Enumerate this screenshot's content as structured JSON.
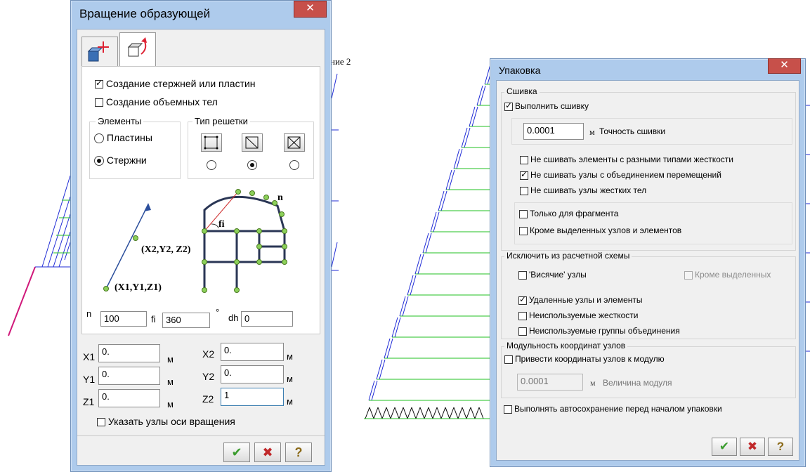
{
  "background": {
    "label_fragment": "ние 2"
  },
  "rotation_dialog": {
    "title": "Вращение образующей",
    "close_symbol": "✕",
    "checkbox_rods_or_plates": {
      "label": "Создание стержней или пластин",
      "checked": true
    },
    "checkbox_solids": {
      "label": "Создание объемных тел",
      "checked": false
    },
    "elements_group": {
      "title": "Элементы",
      "option_plates": "Пластины",
      "option_rods": "Стержни",
      "selected": "Стержни"
    },
    "grid_type_group": {
      "title": "Тип решетки",
      "selected_index": 1
    },
    "diagram": {
      "point2": "(X2,Y2, Z2)",
      "point1": "(X1,Y1,Z1)",
      "angle": "fi",
      "count": "n"
    },
    "param_n": {
      "label": "n",
      "value": "100"
    },
    "param_fi": {
      "label": "fi",
      "value": "360",
      "unit": "°"
    },
    "param_dh": {
      "label": "dh",
      "value": "0"
    },
    "coords": {
      "x1": {
        "label": "X1",
        "value": "0.",
        "unit": "м"
      },
      "y1": {
        "label": "Y1",
        "value": "0.",
        "unit": "м"
      },
      "z1": {
        "label": "Z1",
        "value": "0.",
        "unit": "м"
      },
      "x2": {
        "label": "X2",
        "value": "0.",
        "unit": "м"
      },
      "y2": {
        "label": "Y2",
        "value": "0.",
        "unit": "м"
      },
      "z2": {
        "label": "Z2",
        "value": "1",
        "unit": "м"
      }
    },
    "checkbox_axis_nodes": {
      "label": "Указать узлы оси вращения",
      "checked": false
    },
    "buttons": {
      "ok": "✔",
      "cancel": "✖",
      "help": "?"
    }
  },
  "pack_dialog": {
    "title": "Упаковка",
    "close_symbol": "✕",
    "stitch_group": {
      "title": "Сшивка",
      "do_stitch": {
        "label": "Выполнить сшивку",
        "checked": true
      },
      "precision_value": "0.0001",
      "precision_unit": "м",
      "precision_label": "Точность сшивки",
      "no_diff_stiffness": {
        "label": "Не сшивать элементы с разными типами жесткости",
        "checked": false
      },
      "no_merge_disp": {
        "label": "Не сшивать узлы с объединением перемещений",
        "checked": true
      },
      "no_rigid": {
        "label": "Не сшивать узлы жестких тел",
        "checked": false
      },
      "fragment_only": {
        "label": "Только для фрагмента",
        "checked": false
      },
      "except_selected": {
        "label": "Кроме выделенных узлов и элементов",
        "checked": false
      }
    },
    "exclude_group": {
      "title": "Исключить из расчетной схемы",
      "hanging_nodes": {
        "label": "'Висячие' узлы",
        "checked": false
      },
      "except_selected": {
        "label": "Кроме выделенных",
        "checked": false
      },
      "deleted": {
        "label": "Удаленные узлы и элементы",
        "checked": true
      },
      "unused_stiffness": {
        "label": "Неиспользуемые жесткости",
        "checked": false
      },
      "unused_groups": {
        "label": "Неиспользуемые группы объединения",
        "checked": false
      }
    },
    "modulus_group": {
      "title": "Модульность координат узлов",
      "round_coords": {
        "label": "Привести координаты узлов к модулю",
        "checked": false
      },
      "modulus_value": "0.0001",
      "modulus_unit": "м",
      "modulus_label": "Величина модуля"
    },
    "autosave": {
      "label": "Выполнять автосохранение перед началом упаковки",
      "checked": false
    },
    "buttons": {
      "ok": "✔",
      "cancel": "✖",
      "help": "?"
    }
  }
}
